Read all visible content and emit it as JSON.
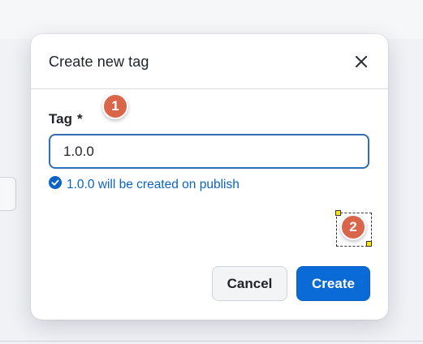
{
  "dialog": {
    "title": "Create new tag",
    "close_icon": "close-icon",
    "field": {
      "label": "Tag",
      "required_mark": "*",
      "value": "1.0.0"
    },
    "hint": {
      "icon": "check-circle-icon",
      "text": "1.0.0 will be created on publish"
    },
    "buttons": {
      "cancel_label": "Cancel",
      "create_label": "Create"
    }
  },
  "annotations": {
    "marker_1": "1",
    "marker_2": "2"
  },
  "colors": {
    "accent": "#0b6bd6",
    "hint_text": "#0b63c4",
    "marker": "#d9654a",
    "handle": "#ffe600"
  }
}
